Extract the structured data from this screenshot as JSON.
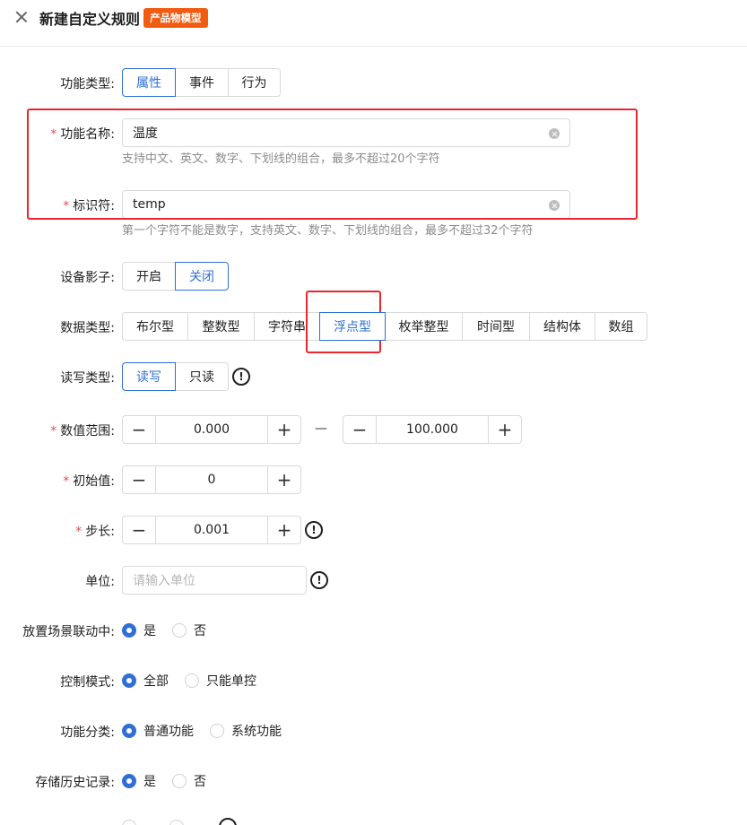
{
  "header": {
    "title": "新建自定义规则",
    "tag": "产品物模型"
  },
  "form": {
    "function_type": {
      "label": "功能类型:",
      "options": [
        "属性",
        "事件",
        "行为"
      ],
      "selected": "属性"
    },
    "function_name": {
      "label": "功能名称:",
      "required": "*",
      "value": "温度",
      "hint": "支持中文、英文、数字、下划线的组合，最多不超过20个字符"
    },
    "identifier": {
      "label": "标识符:",
      "required": "*",
      "value": "temp",
      "hint": "第一个字符不能是数字，支持英文、数字、下划线的组合，最多不超过32个字符"
    },
    "device_shadow": {
      "label": "设备影子:",
      "options": [
        "开启",
        "关闭"
      ],
      "selected": "关闭"
    },
    "data_type": {
      "label": "数据类型:",
      "options": [
        "布尔型",
        "整数型",
        "字符串",
        "浮点型",
        "枚举整型",
        "时间型",
        "结构体",
        "数组"
      ],
      "selected": "浮点型"
    },
    "rw_type": {
      "label": "读写类型:",
      "options": [
        "读写",
        "只读"
      ],
      "selected": "读写"
    },
    "value_range": {
      "label": "数值范围:",
      "required": "*",
      "min": "0.000",
      "max": "100.000",
      "separator": "—"
    },
    "initial_value": {
      "label": "初始值:",
      "required": "*",
      "value": "0"
    },
    "step": {
      "label": "步长:",
      "required": "*",
      "value": "0.001"
    },
    "unit": {
      "label": "单位:",
      "placeholder": "请输入单位"
    },
    "scene_linkage": {
      "label": "放置场景联动中:",
      "options": [
        "是",
        "否"
      ],
      "selected": "是"
    },
    "control_mode": {
      "label": "控制模式:",
      "options": [
        "全部",
        "只能单控"
      ],
      "selected": "全部"
    },
    "function_category": {
      "label": "功能分类:",
      "options": [
        "普通功能",
        "系统功能"
      ],
      "selected": "普通功能"
    },
    "history": {
      "label": "存储历史记录:",
      "options": [
        "是",
        "否"
      ],
      "selected": "是"
    }
  },
  "icons": {
    "close": "close-icon",
    "info": "info-icon",
    "clear": "clear-icon"
  },
  "colors": {
    "accent": "#2f6fd6",
    "tag_bg": "#f25c12",
    "highlight_box": "#e8272e",
    "required": "#e34d59"
  }
}
